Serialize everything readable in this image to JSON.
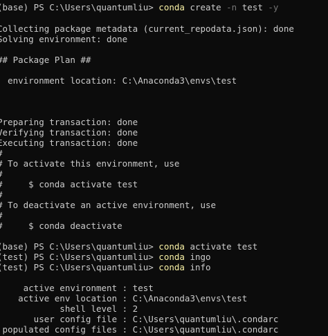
{
  "terminal": {
    "lines": [
      {
        "prompt": "(base) PS C:\\Users\\quantumliu> ",
        "cmd": "conda",
        "args": " create ",
        "flag": "-n",
        "args2": " test ",
        "flag2": "-y"
      },
      {
        "text": "Collecting package metadata (current_repodata.json): done"
      },
      {
        "text": "Solving environment: done"
      },
      {
        "text": ""
      },
      {
        "text": "## Package Plan ##"
      },
      {
        "text": ""
      },
      {
        "text": "  environment location: C:\\Anaconda3\\envs\\test"
      },
      {
        "text": ""
      },
      {
        "text": ""
      },
      {
        "text": ""
      },
      {
        "text": "Preparing transaction: done"
      },
      {
        "text": "Verifying transaction: done"
      },
      {
        "text": "Executing transaction: done"
      },
      {
        "text": "#"
      },
      {
        "text": "# To activate this environment, use"
      },
      {
        "text": "#"
      },
      {
        "text": "#     $ conda activate test"
      },
      {
        "text": "#"
      },
      {
        "text": "# To deactivate an active environment, use"
      },
      {
        "text": "#"
      },
      {
        "text": "#     $ conda deactivate"
      },
      {
        "text": ""
      },
      {
        "prompt": "(base) PS C:\\Users\\quantumliu> ",
        "cmd": "conda",
        "args": " activate test"
      },
      {
        "prompt": "(test) PS C:\\Users\\quantumliu> ",
        "cmd": "conda",
        "args": " ingo"
      },
      {
        "prompt": "(test) PS C:\\Users\\quantumliu> ",
        "cmd": "conda",
        "args": " info"
      },
      {
        "text": ""
      },
      {
        "text": "     active environment : test"
      },
      {
        "text": "    active env location : C:\\Anaconda3\\envs\\test"
      },
      {
        "text": "            shell level : 2"
      },
      {
        "text": "       user config file : C:\\Users\\quantumliu\\.condarc"
      },
      {
        "text": " populated config files : C:\\Users\\quantumliu\\.condarc"
      }
    ]
  }
}
